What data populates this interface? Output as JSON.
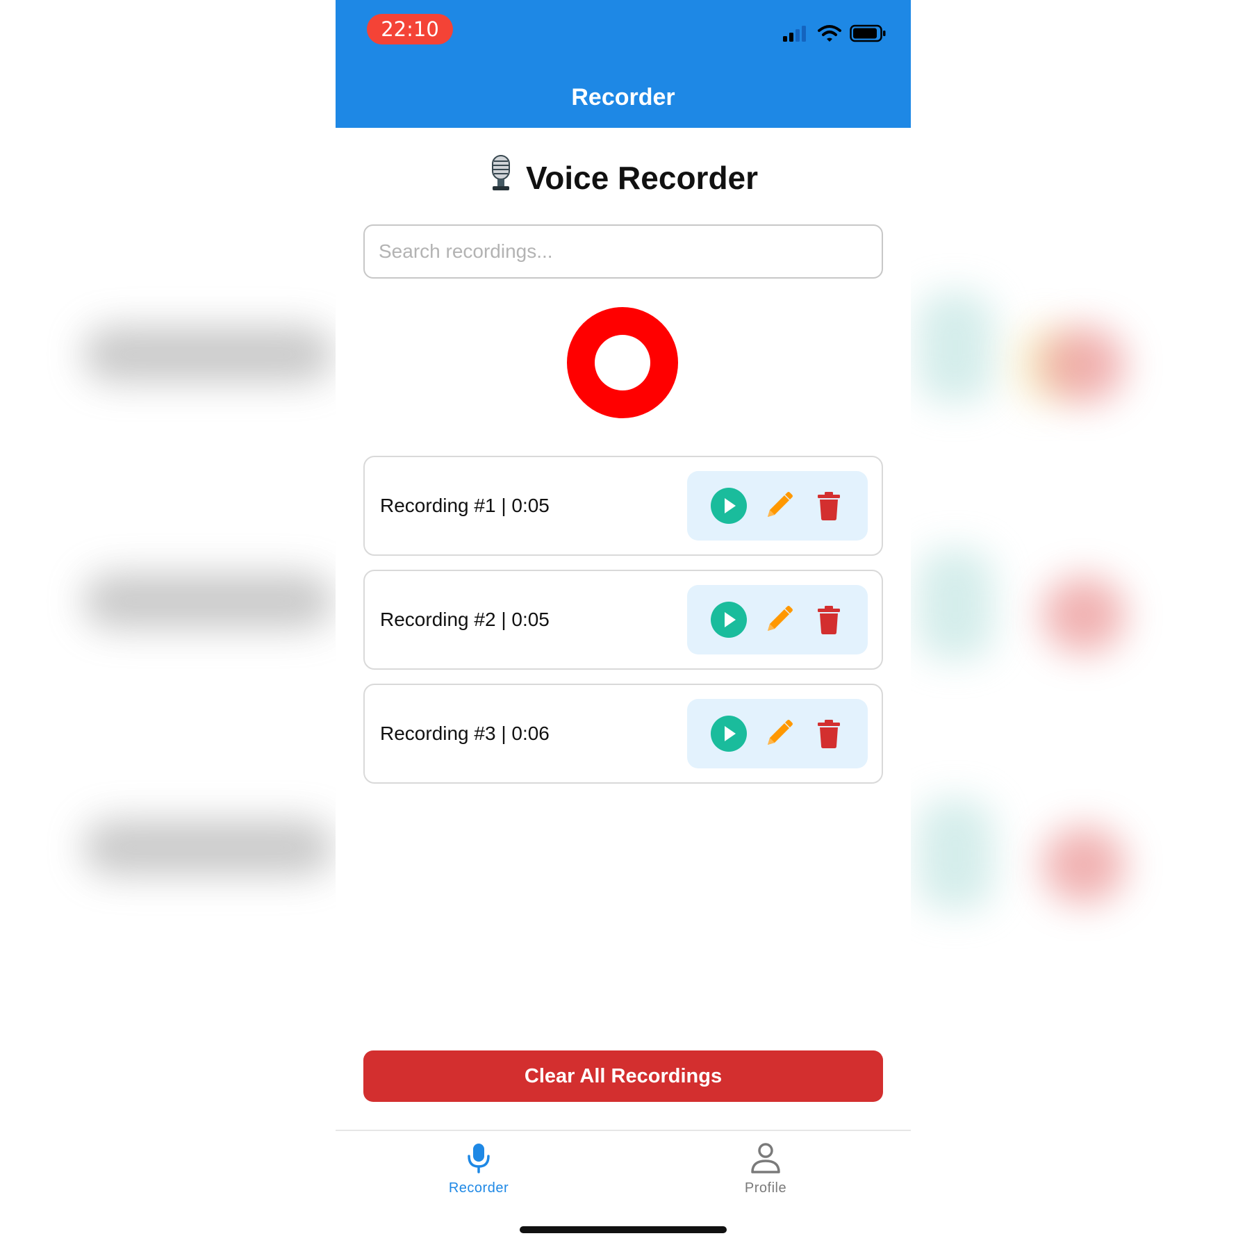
{
  "status_bar": {
    "time": "22:10",
    "time_pill_color": "#f44336",
    "icons": [
      "signal-icon",
      "wifi-icon",
      "battery-icon"
    ]
  },
  "nav": {
    "title": "Recorder",
    "color": "#1e88e5"
  },
  "page": {
    "title": "Voice Recorder",
    "title_icon": "microphone-icon"
  },
  "search": {
    "placeholder": "Search recordings...",
    "value": ""
  },
  "record_button": {
    "icon": "record-button",
    "color": "#ff0000"
  },
  "recordings": [
    {
      "label": "Recording #1 | 0:05"
    },
    {
      "label": "Recording #2 | 0:05"
    },
    {
      "label": "Recording #3 | 0:06"
    }
  ],
  "recording_actions": {
    "play_icon": "play-icon",
    "edit_icon": "pencil-icon",
    "delete_icon": "trash-icon",
    "play_color": "#1abc9c",
    "edit_color": "#ff9800",
    "delete_color": "#d32f2f"
  },
  "clear_button": {
    "label": "Clear All Recordings",
    "color": "#d32f2f"
  },
  "tabs": [
    {
      "label": "Recorder",
      "icon": "microphone-icon",
      "active": true
    },
    {
      "label": "Profile",
      "icon": "person-icon",
      "active": false
    }
  ]
}
